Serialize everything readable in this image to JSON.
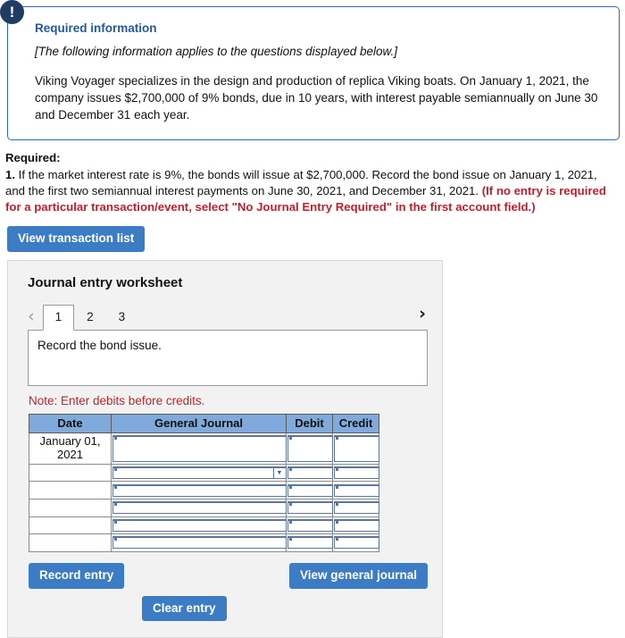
{
  "alert": {
    "icon": "exclamation-icon",
    "glyph": "!"
  },
  "required_info": {
    "title": "Required information",
    "italic_note": "[The following information applies to the questions displayed below.]",
    "body": "Viking Voyager specializes in the design and production of replica Viking boats. On January 1, 2021, the company issues $2,700,000 of 9% bonds, due in 10 years, with interest payable semiannually on June 30 and December 31 each year."
  },
  "required": {
    "label": "Required:",
    "number": "1.",
    "text_part1": "If the market interest rate is 9%, the bonds will issue at $2,700,000. Record the bond issue on January 1, 2021, and the first two semiannual interest payments on June 30, 2021, and December 31, 2021.",
    "text_red": "(If no entry is required for a particular transaction/event, select \"No Journal Entry Required\" in the first account field.)"
  },
  "view_transaction_list_button": "View transaction list",
  "worksheet": {
    "title": "Journal entry worksheet",
    "pager": {
      "prev_icon": "chevron-left-icon",
      "next_icon": "chevron-right-icon",
      "prev_glyph": "‹",
      "next_glyph": "›",
      "tabs": [
        {
          "label": "1",
          "active": true
        },
        {
          "label": "2",
          "active": false
        },
        {
          "label": "3",
          "active": false
        }
      ]
    },
    "prompt": "Record the bond issue.",
    "note": "Note: Enter debits before credits.",
    "table": {
      "columns": [
        "Date",
        "General Journal",
        "Debit",
        "Credit"
      ],
      "rows": [
        {
          "date": "January 01, 2021",
          "general_journal": "",
          "debit": "",
          "credit": "",
          "tall": true,
          "dropdown": false
        },
        {
          "date": "",
          "general_journal": "",
          "debit": "",
          "credit": "",
          "tall": false,
          "dropdown": true
        },
        {
          "date": "",
          "general_journal": "",
          "debit": "",
          "credit": "",
          "tall": false,
          "dropdown": false
        },
        {
          "date": "",
          "general_journal": "",
          "debit": "",
          "credit": "",
          "tall": false,
          "dropdown": false
        },
        {
          "date": "",
          "general_journal": "",
          "debit": "",
          "credit": "",
          "tall": false,
          "dropdown": false
        },
        {
          "date": "",
          "general_journal": "",
          "debit": "",
          "credit": "",
          "tall": false,
          "dropdown": false
        }
      ]
    },
    "buttons": {
      "record_entry": "Record entry",
      "clear_entry": "Clear entry",
      "view_general_journal": "View general journal"
    }
  },
  "colors": {
    "accent_blue": "#3c7cc4",
    "callout_border": "#2c6cb0",
    "title_blue": "#1f5a9e",
    "alert_navy": "#1f3c64",
    "warning_red": "#c0202e",
    "note_red": "#b02a30",
    "table_header_blue": "#80a9dc",
    "panel_gray": "#f2f2f2"
  }
}
